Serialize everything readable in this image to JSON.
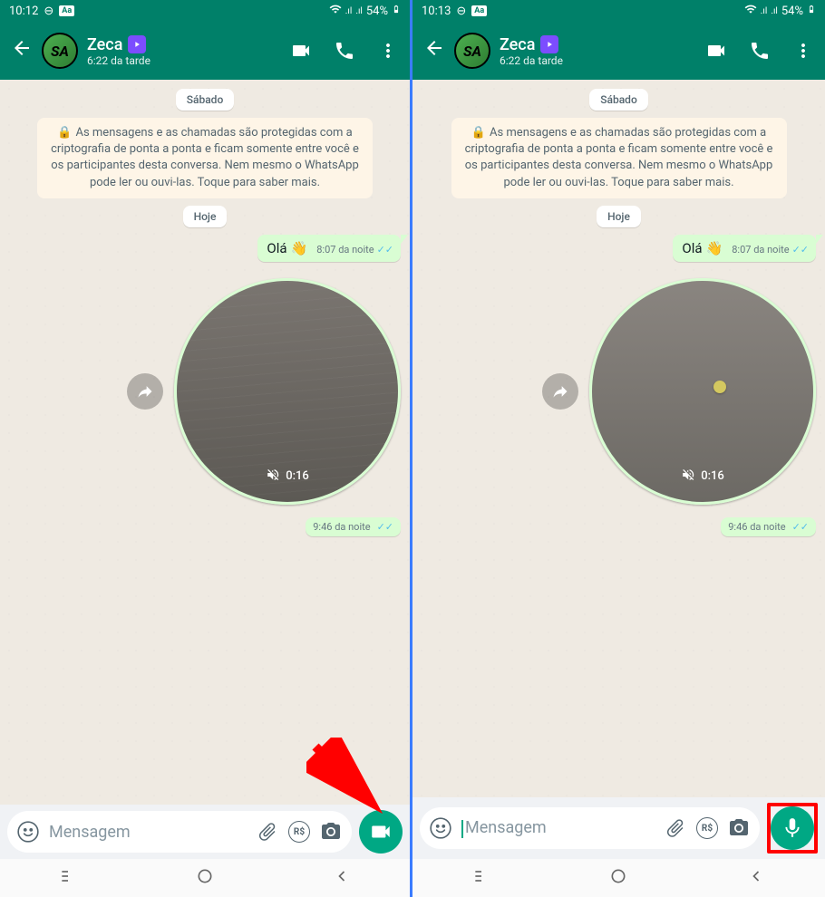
{
  "left": {
    "status": {
      "time": "10:12",
      "battery": "54%"
    },
    "header": {
      "contact_name": "Zeca",
      "contact_subtitle": "6:22 da tarde",
      "avatar_text": "SA"
    },
    "chat": {
      "date1": "Sábado",
      "encryption": "As mensagens e as chamadas são protegidas com a criptografia de ponta a ponta e ficam somente entre você e os participantes desta conversa. Nem mesmo o WhatsApp pode ler ou ouvi-las. Toque para saber mais.",
      "date2": "Hoje",
      "msg1_text": "Olá",
      "msg1_emoji": "👋",
      "msg1_time": "8:07 da noite",
      "video_duration": "0:16",
      "video_time": "9:46 da noite"
    },
    "input": {
      "placeholder": "Mensagem",
      "rs_label": "R$"
    }
  },
  "right": {
    "status": {
      "time": "10:13",
      "battery": "54%"
    },
    "header": {
      "contact_name": "Zeca",
      "contact_subtitle": "6:22 da tarde",
      "avatar_text": "SA"
    },
    "chat": {
      "date1": "Sábado",
      "encryption": "As mensagens e as chamadas são protegidas com a criptografia de ponta a ponta e ficam somente entre você e os participantes desta conversa. Nem mesmo o WhatsApp pode ler ou ouvi-las. Toque para saber mais.",
      "date2": "Hoje",
      "msg1_text": "Olá",
      "msg1_emoji": "👋",
      "msg1_time": "8:07 da noite",
      "video_duration": "0:16",
      "video_time": "9:46 da noite"
    },
    "input": {
      "placeholder": "Mensagem",
      "rs_label": "R$"
    }
  }
}
